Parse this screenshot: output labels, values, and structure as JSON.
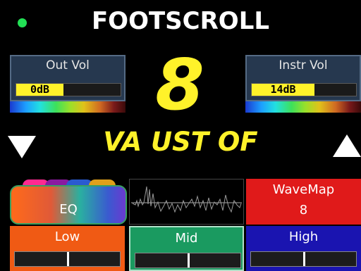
{
  "header": {
    "title": "FOOTSCROLL",
    "status_color": "#22e055"
  },
  "out_vol": {
    "label": "Out Vol",
    "value": "0dB",
    "level": 0.45
  },
  "instr_vol": {
    "label": "Instr Vol",
    "value": "14dB",
    "level": 0.6
  },
  "preset": {
    "number": "8",
    "name": "VA UST OF"
  },
  "nav": {
    "down_icon": "triangle-down",
    "up_icon": "triangle-up"
  },
  "tiles": {
    "eq": {
      "label": "EQ"
    },
    "waveform": {
      "icon": "waveform"
    },
    "wavemap": {
      "label": "WaveMap",
      "value": "8",
      "color": "#e01a1a"
    }
  },
  "bands": [
    {
      "label": "Low",
      "color": "#f05a14",
      "level": 0.5
    },
    {
      "label": "Mid",
      "color": "#1a9a60",
      "level": 0.5
    },
    {
      "label": "High",
      "color": "#1a14b0",
      "level": 0.5
    }
  ],
  "colors": {
    "accent_yellow": "#fff22a",
    "panel": "#26384f"
  }
}
